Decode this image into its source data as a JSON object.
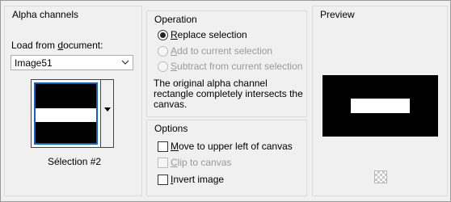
{
  "alpha": {
    "title": "Alpha channels",
    "load_label": "Load from document:",
    "load_label_underline": "d",
    "load_pre": "Load from ",
    "load_post": "ocument:",
    "document_value": "Image51",
    "selection_name": "Sélection #2"
  },
  "operation": {
    "title": "Operation",
    "options": [
      {
        "u": "R",
        "rest": "eplace selection",
        "selected": true,
        "enabled": true
      },
      {
        "u": "A",
        "rest": "dd to current selection",
        "selected": false,
        "enabled": false
      },
      {
        "u": "S",
        "rest": "ubtract from current selection",
        "selected": false,
        "enabled": false
      }
    ],
    "description": "The original alpha channel rectangle completely intersects the canvas."
  },
  "options": {
    "title": "Options",
    "items": [
      {
        "u": "M",
        "rest": "ove to upper left of canvas",
        "checked": false,
        "enabled": true
      },
      {
        "u": "C",
        "rest": "lip to canvas",
        "checked": false,
        "enabled": false
      },
      {
        "u": "I",
        "rest": "nvert image",
        "checked": false,
        "enabled": true
      }
    ]
  },
  "preview": {
    "title": "Preview"
  },
  "colors": {
    "selection_border": "#0a64c8",
    "preview_bg": "#000000"
  }
}
